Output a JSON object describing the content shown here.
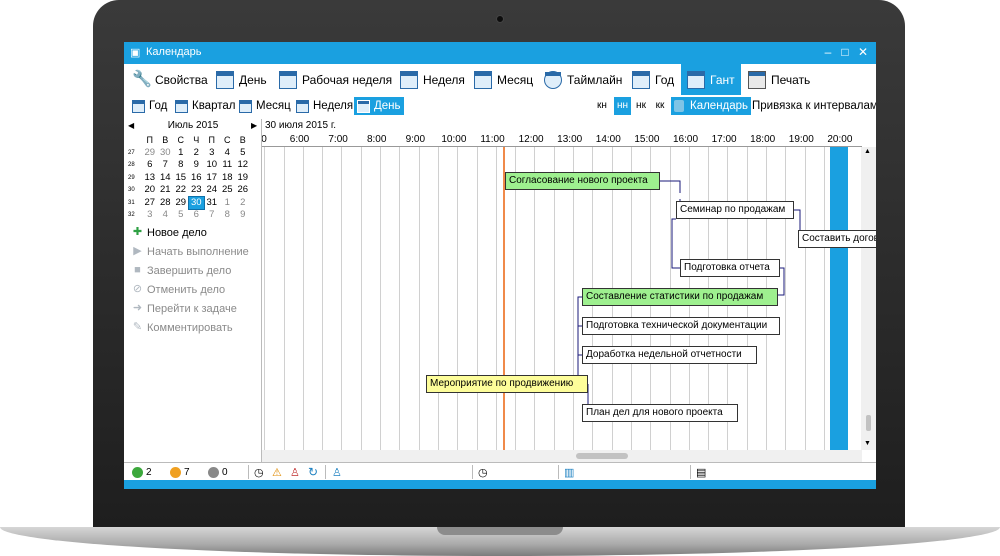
{
  "window": {
    "title": "Календарь"
  },
  "toolbar": {
    "items": [
      {
        "label": "Свойства",
        "icon": "wrench-icon"
      },
      {
        "label": "День",
        "icon": "calendar-day-icon"
      },
      {
        "label": "Рабочая неделя",
        "icon": "calendar-workweek-icon"
      },
      {
        "label": "Неделя",
        "icon": "calendar-week-icon"
      },
      {
        "label": "Месяц",
        "icon": "calendar-month-icon"
      },
      {
        "label": "Таймлайн",
        "icon": "timeline-icon"
      },
      {
        "label": "Год",
        "icon": "calendar-year-icon"
      },
      {
        "label": "Гант",
        "icon": "gantt-icon",
        "active": true
      },
      {
        "label": "Печать",
        "icon": "printer-icon"
      }
    ]
  },
  "subtoolbar": {
    "items": [
      {
        "label": "Год"
      },
      {
        "label": "Квартал"
      },
      {
        "label": "Месяц"
      },
      {
        "label": "Неделя"
      },
      {
        "label": "День",
        "active": true
      }
    ],
    "segments": [
      "кн",
      "нн",
      "нк",
      "кк"
    ],
    "segment_active": "нн",
    "calendar_label": "Календарь",
    "snap_label": "Привязка к интервалам"
  },
  "calendar": {
    "month_label": "Июль 2015",
    "weekdays": [
      "П",
      "В",
      "С",
      "Ч",
      "П",
      "С",
      "В"
    ],
    "weeks": [
      {
        "num": "27",
        "days": [
          "29",
          "30",
          "1",
          "2",
          "3",
          "4",
          "5"
        ]
      },
      {
        "num": "28",
        "days": [
          "6",
          "7",
          "8",
          "9",
          "10",
          "11",
          "12"
        ]
      },
      {
        "num": "29",
        "days": [
          "13",
          "14",
          "15",
          "16",
          "17",
          "18",
          "19"
        ]
      },
      {
        "num": "30",
        "days": [
          "20",
          "21",
          "22",
          "23",
          "24",
          "25",
          "26"
        ]
      },
      {
        "num": "31",
        "days": [
          "27",
          "28",
          "29",
          "30",
          "31",
          "1",
          "2"
        ]
      },
      {
        "num": "32",
        "days": [
          "3",
          "4",
          "5",
          "6",
          "7",
          "8",
          "9"
        ]
      }
    ],
    "selected": "30"
  },
  "actions": [
    {
      "label": "Новое дело",
      "enabled": true,
      "icon": "plus-icon"
    },
    {
      "label": "Начать выполнение",
      "enabled": false,
      "icon": "play-icon"
    },
    {
      "label": "Завершить дело",
      "enabled": false,
      "icon": "stop-icon"
    },
    {
      "label": "Отменить дело",
      "enabled": false,
      "icon": "cancel-icon"
    },
    {
      "label": "Перейти к задаче",
      "enabled": false,
      "icon": "arrow-right-icon"
    },
    {
      "label": "Комментировать",
      "enabled": false,
      "icon": "pencil-icon"
    }
  ],
  "gantt": {
    "date": "30 июля 2015 г.",
    "hours": [
      "6:00",
      "7:00",
      "8:00",
      "9:00",
      "10:00",
      "11:00",
      "12:00",
      "13:00",
      "14:00",
      "15:00",
      "16:00",
      "17:00",
      "18:00",
      "19:00",
      "20:00"
    ],
    "first_hour_fragment": "0",
    "tasks": [
      {
        "label": "Согласование нового проекта",
        "color": "#9ef08f"
      },
      {
        "label": "Семинар по продажам",
        "color": "#ffffff"
      },
      {
        "label": "Составить договор об аренде",
        "color": "#ffffff"
      },
      {
        "label": "Подготовка отчета",
        "color": "#ffffff"
      },
      {
        "label": "Составление статистики по продажам",
        "color": "#9ef08f"
      },
      {
        "label": "Подготовка технической документации",
        "color": "#ffffff"
      },
      {
        "label": "Доработка недельной отчетности",
        "color": "#ffffff"
      },
      {
        "label": "Мероприятие по продвижению",
        "color": "#fdfd9a"
      },
      {
        "label": "План дел для нового проекта",
        "color": "#ffffff"
      }
    ]
  },
  "status": {
    "green_count": "2",
    "orange_count": "7",
    "gray_count": "0"
  },
  "colors": {
    "accent": "#1aa0e0",
    "now_line": "#f08a4a"
  }
}
